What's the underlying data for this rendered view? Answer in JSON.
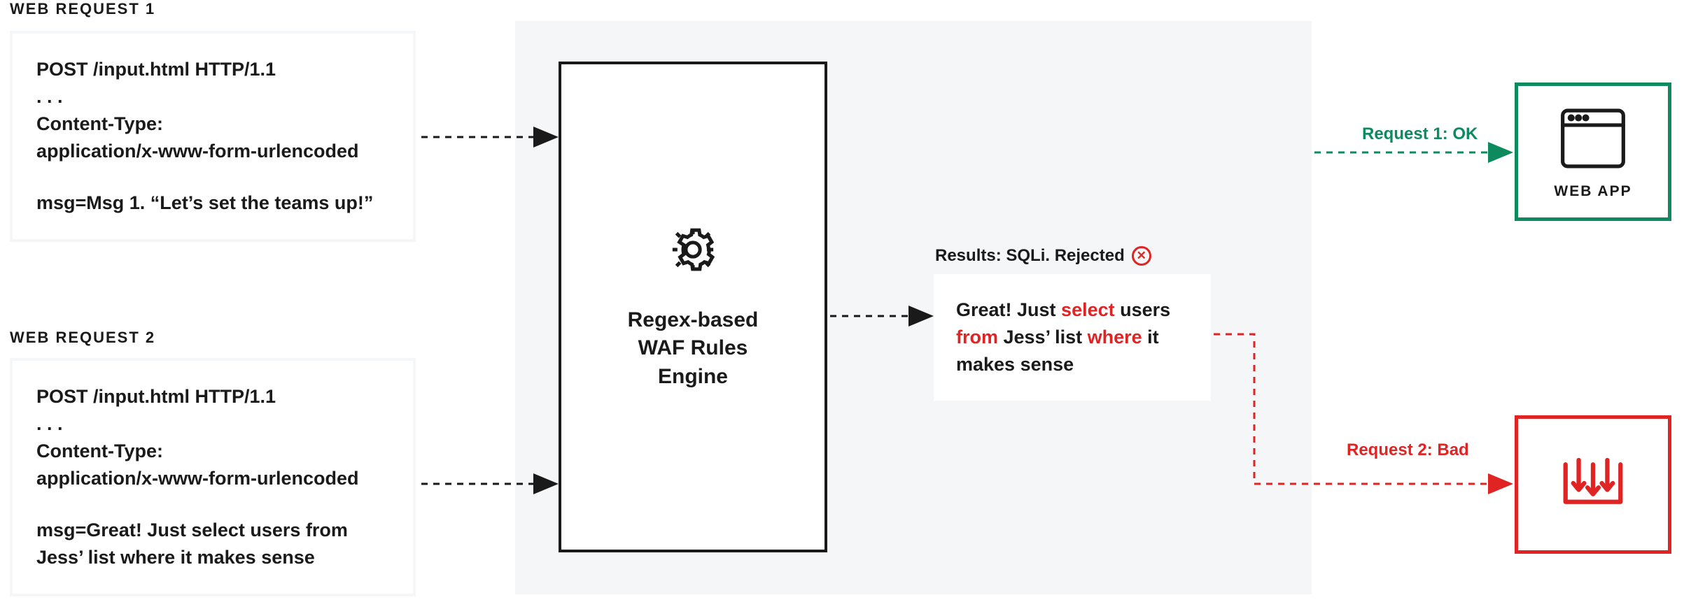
{
  "labels": {
    "req1": "WEB REQUEST 1",
    "req2": "WEB REQUEST 2"
  },
  "req1": {
    "line1": "POST /input.html HTTP/1.1",
    "line2": ". . .",
    "line3": "Content-Type:",
    "line4": "application/x-www-form-urlencoded",
    "msg": "msg=Msg 1. “Let’s set the teams up!”"
  },
  "req2": {
    "line1": "POST /input.html HTTP/1.1",
    "line2": ". . .",
    "line3": "Content-Type:",
    "line4": "application/x-www-form-urlencoded",
    "msg": "msg=Great! Just select users from Jess’ list where it makes sense"
  },
  "engine": {
    "title_line1": "Regex-based",
    "title_line2": "WAF Rules",
    "title_line3": "Engine"
  },
  "result": {
    "label": "Results: SQLi. Rejected",
    "t1": "Great! Just ",
    "kw1": "select",
    "t2": " users ",
    "kw2": "from",
    "t3": " Jess’ list ",
    "kw3": "where",
    "t4": " it makes sense"
  },
  "outcomes": {
    "ok": "Request 1: OK",
    "bad": "Request 2: Bad",
    "webapp": "WEB APP"
  }
}
